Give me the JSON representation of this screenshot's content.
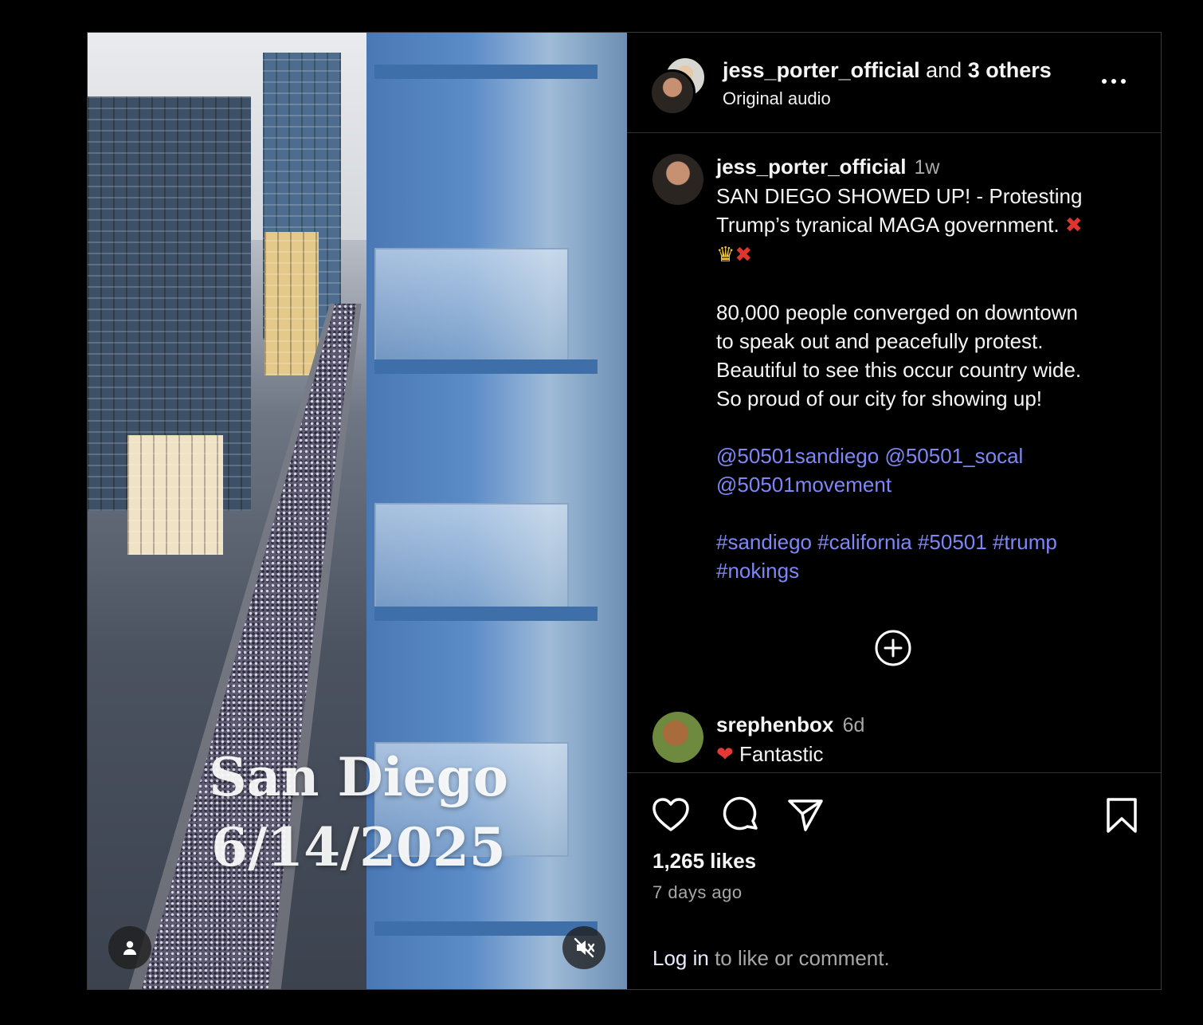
{
  "media": {
    "overlay_line1": "San Diego",
    "overlay_line2": "6/14/2025"
  },
  "header": {
    "username": "jess_porter_official",
    "and_text": "and",
    "others": "3 others",
    "subtitle": "Original audio"
  },
  "caption": {
    "username": "jess_porter_official",
    "time": "1w",
    "line1": "SAN DIEGO SHOWED UP! - Protesting",
    "line2": "Trump’s tyranical MAGA government.",
    "emoji_x": "✖",
    "emoji_crown": "♛",
    "para2": [
      "80,000 people converged on downtown",
      "to speak out and peacefully protest.",
      "Beautiful to see this occur country wide.",
      "So proud of our city for showing up!"
    ],
    "mentions": [
      "@50501sandiego @50501_socal",
      "@50501movement"
    ],
    "hashtags": [
      "#sandiego #california #50501 #trump",
      "#nokings"
    ]
  },
  "comment": {
    "username": "srephenbox",
    "time": "6d",
    "heart": "❤",
    "text": "Fantastic"
  },
  "stats": {
    "likes": "1,265 likes",
    "ago": "7 days ago"
  },
  "login": {
    "link": "Log in",
    "rest": " to like or comment."
  },
  "colors": {
    "accent_link": "#7f86f5",
    "muted": "#a8a8a8",
    "background": "#000000"
  },
  "icons": [
    "person-icon",
    "mute-icon",
    "more-icon",
    "add-comment-icon",
    "heart-icon",
    "comment-icon",
    "share-icon",
    "bookmark-icon"
  ]
}
